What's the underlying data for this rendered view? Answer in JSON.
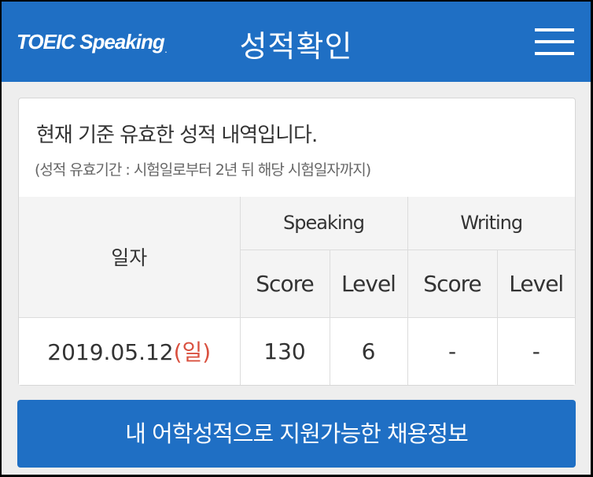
{
  "header": {
    "logo_text": "TOEIC Speaking",
    "logo_mark": ".",
    "title": "성적확인"
  },
  "info": {
    "headline": "현재 기준 유효한 성적 내역입니다.",
    "note": "(성적 유효기간 : 시험일로부터 2년 뒤 해당 시험일자까지)"
  },
  "table": {
    "date_header": "일자",
    "groups": [
      "Speaking",
      "Writing"
    ],
    "subheaders": [
      "Score",
      "Level",
      "Score",
      "Level"
    ],
    "rows": [
      {
        "date": "2019.05.12",
        "day": "(일)",
        "speaking_score": "130",
        "speaking_level": "6",
        "writing_score": "-",
        "writing_level": "-"
      }
    ]
  },
  "cta": {
    "label": "내 어학성적으로 지원가능한 채용정보"
  },
  "colors": {
    "brand_blue": "#1f6fc4",
    "day_red": "#d9503f"
  },
  "icons": {
    "menu": "hamburger-menu-icon"
  }
}
